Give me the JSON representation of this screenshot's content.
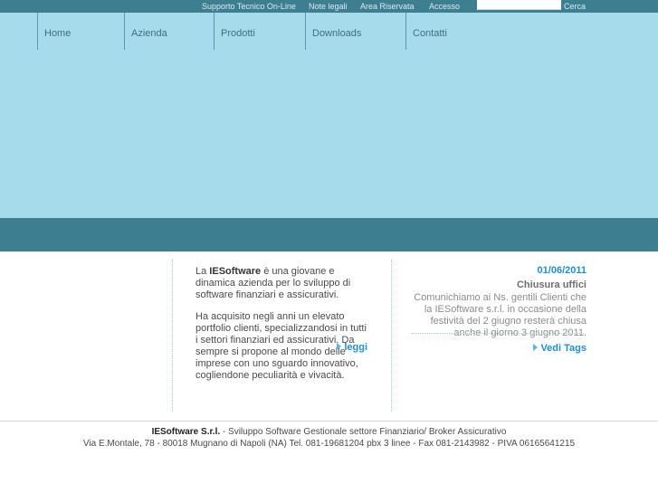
{
  "topbar": {
    "links": [
      {
        "label": "Supporto Tecnico On-Line"
      },
      {
        "label": "Note legali"
      },
      {
        "label": "Area Riservata"
      },
      {
        "label": "Accesso"
      }
    ],
    "search": {
      "value": "",
      "placeholder": "",
      "button_label": "Cerca"
    },
    "background_color": "#3d7f91"
  },
  "nav": {
    "items": [
      {
        "label": "Home"
      },
      {
        "label": "Azienda"
      },
      {
        "label": "Prodotti"
      },
      {
        "label": "Downloads"
      },
      {
        "label": "Contatti"
      }
    ],
    "background_color": "#a5dbea",
    "band_color": "#3d7f91"
  },
  "main": {
    "intro": {
      "p1_prefix": "La ",
      "p1_brand": "IESoftware",
      "p1_rest": " è una giovane e dinamica azienda per lo sviluppo di software finanziari e assicurativi.",
      "p2": "Ha acquisito negli anni un elevato portfolio clienti, specializzandosi in tutti i settori finanziari ed assicurativi. Da sempre si propone al mondo delle imprese con uno sguardo innovativo, cogliendone peculiarità e vivacità.",
      "read_more_label": "leggi"
    },
    "news": {
      "date": "01/06/2011",
      "title": "Chiusura uffici",
      "body": "Comunichiamo ai Ns. gentili Clienti che la IESoftware s.r.l. in occasione della festività del 2 giugno resterà chiusa anche il giorno 3 giugno 2011.",
      "tags_label": "Vedi Tags"
    },
    "link_color": "#1f8fd0"
  },
  "footer": {
    "line1_bold": "IESoftware S.r.l.",
    "line1_rest": " - Sviluppo Software Gestionale settore Finanziario/ Broker Assicurativo",
    "line2": "Via E.Montale, 78 - 80018 Mugnano di Napoli (NA) Tel. 081-19681204 pbx 3 linee - Fax 081-2143982 - PIVA 06165641215"
  }
}
